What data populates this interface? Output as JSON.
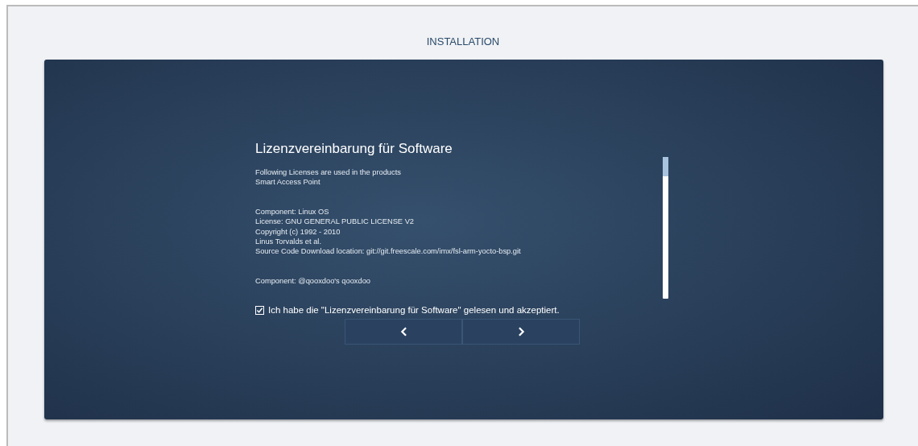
{
  "header": {
    "title": "INSTALLATION"
  },
  "license": {
    "heading": "Lizenzvereinbarung für Software",
    "paragraphs": [
      [
        "Following Licenses are used in the products",
        "Smart Access Point"
      ],
      [
        "Component: Linux OS",
        "License: GNU GENERAL PUBLIC LICENSE V2",
        "Copyright (c) 1992 - 2010",
        "Linus Torvalds et al.",
        "Source Code Download location: git://git.freescale.com/imx/fsl-arm-yocto-bsp.git"
      ],
      [
        "Component: @qooxdoo's qooxdoo"
      ]
    ]
  },
  "accept": {
    "label": "Ich habe die \"Lizenzvereinbarung für Software\" gelesen und akzeptiert.",
    "checked": true
  },
  "buttons": [
    {
      "kind": "back"
    },
    {
      "kind": "next"
    }
  ]
}
